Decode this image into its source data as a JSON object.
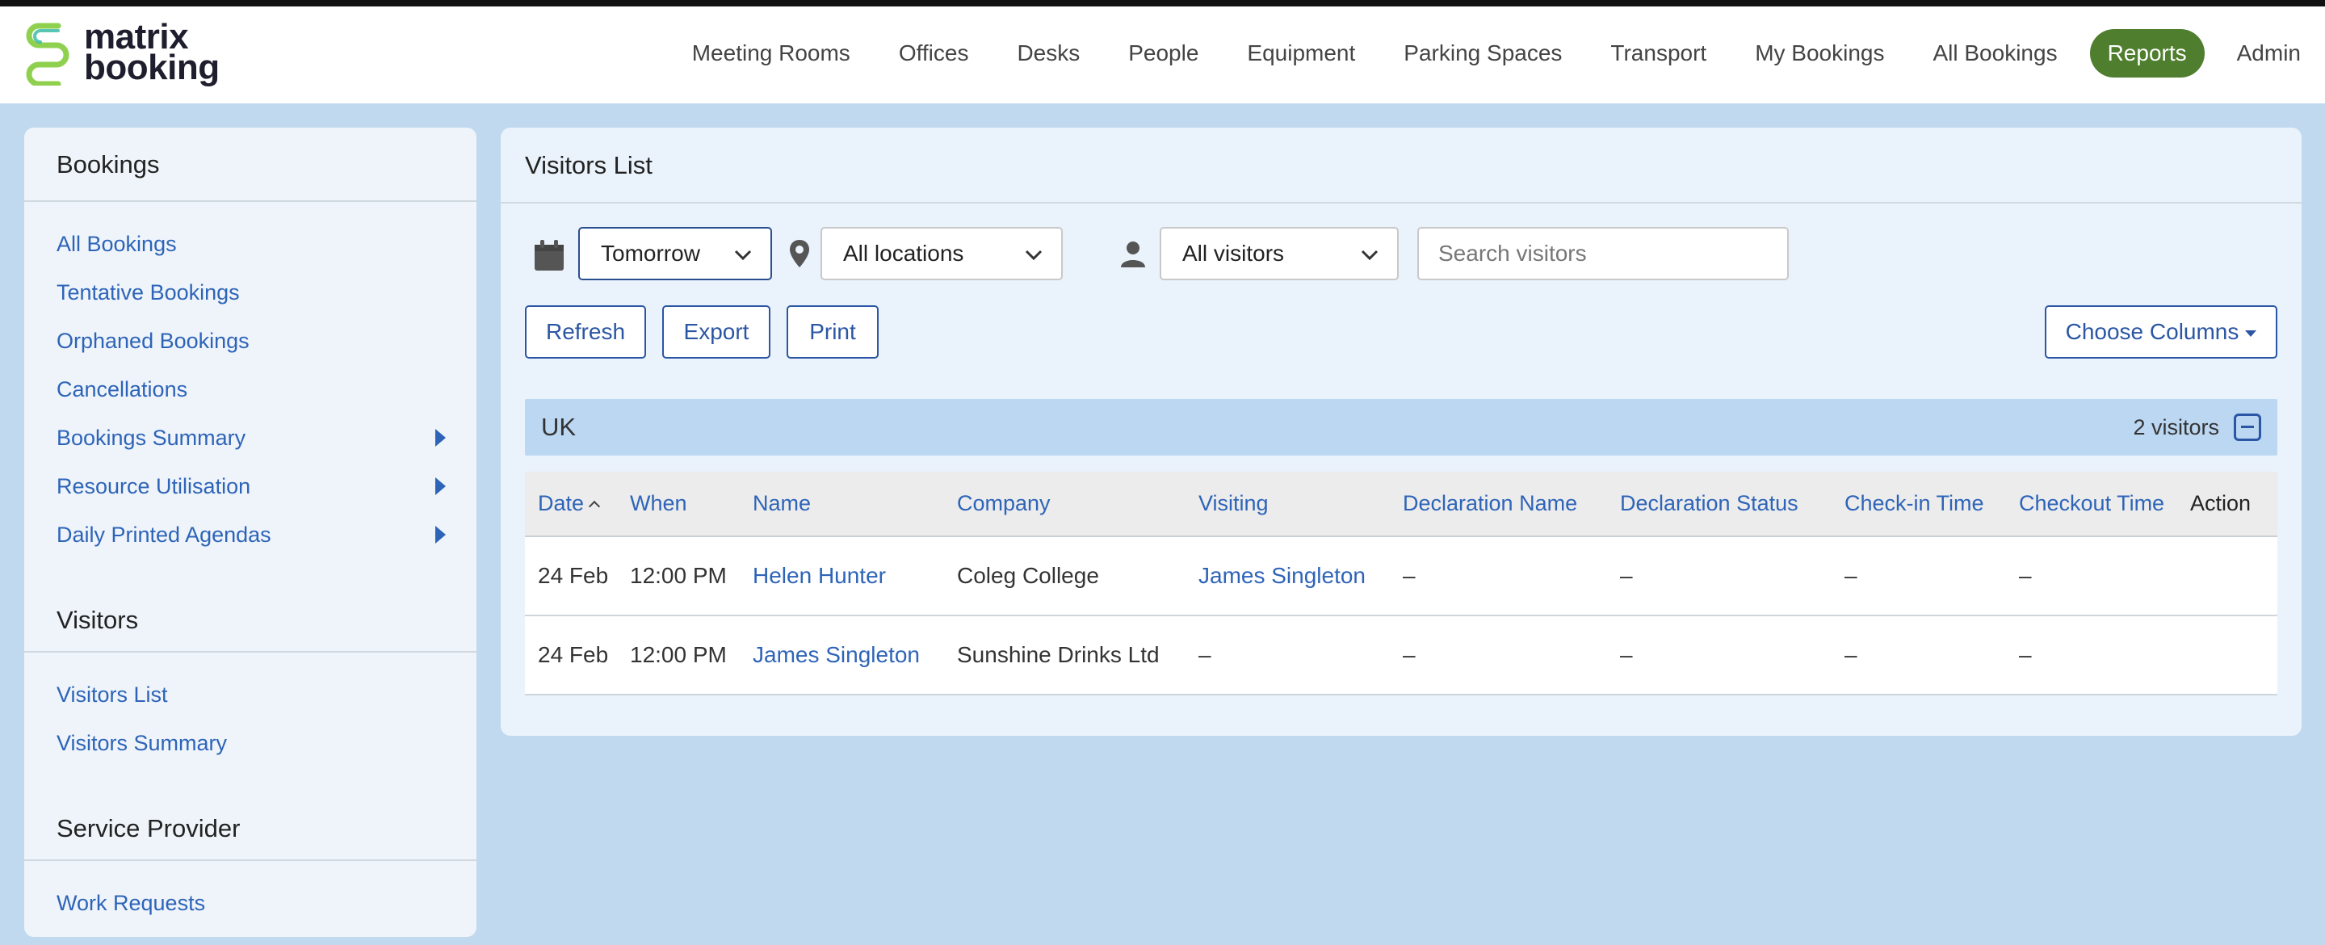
{
  "header": {
    "logo_line1": "matrix",
    "logo_line2": "booking",
    "nav": [
      {
        "label": "Meeting Rooms"
      },
      {
        "label": "Offices"
      },
      {
        "label": "Desks"
      },
      {
        "label": "People"
      },
      {
        "label": "Equipment"
      },
      {
        "label": "Parking Spaces"
      },
      {
        "label": "Transport"
      },
      {
        "label": "My Bookings"
      },
      {
        "label": "All Bookings"
      },
      {
        "label": "Reports",
        "active": true
      },
      {
        "label": "Admin"
      }
    ]
  },
  "sidebar": {
    "sections": [
      {
        "title": "Bookings",
        "items": [
          {
            "label": "All Bookings"
          },
          {
            "label": "Tentative Bookings"
          },
          {
            "label": "Orphaned Bookings"
          },
          {
            "label": "Cancellations"
          },
          {
            "label": "Bookings Summary",
            "has_submenu": true
          },
          {
            "label": "Resource Utilisation",
            "has_submenu": true
          },
          {
            "label": "Daily Printed Agendas",
            "has_submenu": true
          }
        ]
      },
      {
        "title": "Visitors",
        "items": [
          {
            "label": "Visitors List"
          },
          {
            "label": "Visitors Summary"
          }
        ]
      },
      {
        "title": "Service Provider",
        "items": [
          {
            "label": "Work Requests"
          }
        ]
      }
    ]
  },
  "main": {
    "title": "Visitors List",
    "filters": {
      "date": "Tomorrow",
      "location": "All locations",
      "visitor_type": "All visitors",
      "search_placeholder": "Search visitors"
    },
    "buttons": {
      "refresh": "Refresh",
      "export": "Export",
      "print": "Print",
      "choose_columns": "Choose Columns"
    },
    "group": {
      "name": "UK",
      "count": "2 visitors"
    },
    "table": {
      "columns": [
        "Date",
        "When",
        "Name",
        "Company",
        "Visiting",
        "Declaration Name",
        "Declaration Status",
        "Check-in Time",
        "Checkout Time",
        "Action"
      ],
      "rows": [
        {
          "date": "24 Feb",
          "when": "12:00 PM",
          "name": "Helen Hunter",
          "company": "Coleg College",
          "visiting": "James Singleton",
          "declaration_name": "–",
          "declaration_status": "–",
          "checkin": "–",
          "checkout": "–",
          "action": ""
        },
        {
          "date": "24 Feb",
          "when": "12:00 PM",
          "name": "James Singleton",
          "company": "Sunshine Drinks Ltd",
          "visiting": "–",
          "declaration_name": "–",
          "declaration_status": "–",
          "checkin": "–",
          "checkout": "–",
          "action": ""
        }
      ]
    }
  },
  "colors": {
    "accent_green": "#4f7e2e",
    "link_blue": "#2e64b8",
    "page_bg": "#c0d9ef",
    "group_bg": "#bcd7f2"
  }
}
